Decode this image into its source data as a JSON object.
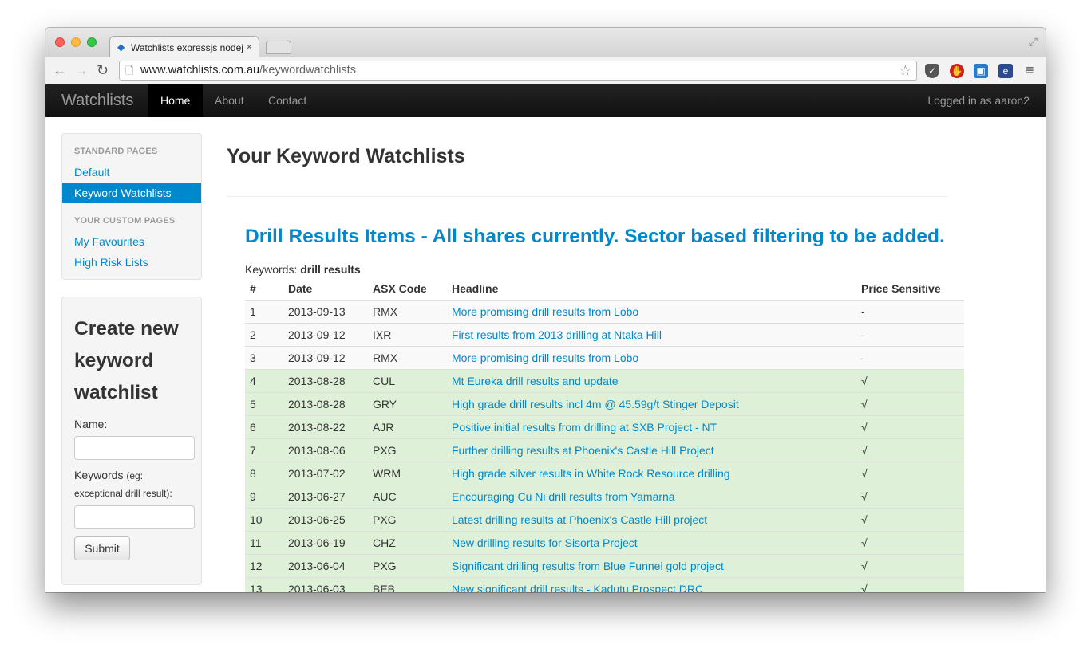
{
  "browser": {
    "tab_title": "Watchlists expressjs nodejs",
    "tab_close": "×",
    "url_host": "www.watchlists.com.au",
    "url_path": "/keywordwatchlists",
    "back_glyph": "←",
    "forward_glyph": "→",
    "reload_glyph": "↻",
    "star_glyph": "☆",
    "menu_glyph": "≡"
  },
  "navbar": {
    "brand": "Watchlists",
    "links": [
      "Home",
      "About",
      "Contact"
    ],
    "active": "Home",
    "logged_in": "Logged in as aaron2"
  },
  "sidebar": {
    "standard_header": "STANDARD PAGES",
    "standard_items": [
      "Default",
      "Keyword Watchlists"
    ],
    "active_item": "Keyword Watchlists",
    "custom_header": "YOUR CUSTOM PAGES",
    "custom_items": [
      "My Favourites",
      "High Risk Lists"
    ]
  },
  "create_form": {
    "title": "Create new keyword watchlist",
    "name_label": "Name:",
    "keywords_label": "Keywords",
    "keywords_hint": "(eg: exceptional drill result):",
    "submit_label": "Submit"
  },
  "main": {
    "title": "Your Keyword Watchlists",
    "list_title": "Drill Results Items - All shares currently. Sector based filtering to be added.",
    "keywords_label": "Keywords:",
    "keywords_value": "drill results",
    "columns": [
      "#",
      "Date",
      "ASX Code",
      "Headline",
      "Price Sensitive"
    ],
    "rows": [
      {
        "num": "1",
        "date": "2013-09-13",
        "code": "RMX",
        "headline": "More promising drill results from Lobo",
        "sensitive": "-"
      },
      {
        "num": "2",
        "date": "2013-09-12",
        "code": "IXR",
        "headline": "First results from 2013 drilling at Ntaka Hill",
        "sensitive": "-"
      },
      {
        "num": "3",
        "date": "2013-09-12",
        "code": "RMX",
        "headline": "More promising drill results from Lobo",
        "sensitive": "-"
      },
      {
        "num": "4",
        "date": "2013-08-28",
        "code": "CUL",
        "headline": "Mt Eureka drill results and update",
        "sensitive": "√"
      },
      {
        "num": "5",
        "date": "2013-08-28",
        "code": "GRY",
        "headline": "High grade drill results incl 4m @ 45.59g/t Stinger Deposit",
        "sensitive": "√"
      },
      {
        "num": "6",
        "date": "2013-08-22",
        "code": "AJR",
        "headline": "Positive initial results from drilling at SXB Project - NT",
        "sensitive": "√"
      },
      {
        "num": "7",
        "date": "2013-08-06",
        "code": "PXG",
        "headline": "Further drilling results at Phoenix's Castle Hill Project",
        "sensitive": "√"
      },
      {
        "num": "8",
        "date": "2013-07-02",
        "code": "WRM",
        "headline": "High grade silver results in White Rock Resource drilling",
        "sensitive": "√"
      },
      {
        "num": "9",
        "date": "2013-06-27",
        "code": "AUC",
        "headline": "Encouraging Cu Ni drill results from Yamarna",
        "sensitive": "√"
      },
      {
        "num": "10",
        "date": "2013-06-25",
        "code": "PXG",
        "headline": "Latest drilling results at Phoenix's Castle Hill project",
        "sensitive": "√"
      },
      {
        "num": "11",
        "date": "2013-06-19",
        "code": "CHZ",
        "headline": "New drilling results for Sisorta Project",
        "sensitive": "√"
      },
      {
        "num": "12",
        "date": "2013-06-04",
        "code": "PXG",
        "headline": "Significant drilling results from Blue Funnel gold project",
        "sensitive": "√"
      },
      {
        "num": "13",
        "date": "2013-06-03",
        "code": "BEB",
        "headline": "New significant drill results - Kadutu Prospect DRC",
        "sensitive": "√"
      }
    ]
  },
  "colors": {
    "accent": "#0088cc",
    "navbar_bg": "#1b1b1b",
    "success_row": "#dff0d8",
    "odd_row": "#f9f9f9"
  }
}
